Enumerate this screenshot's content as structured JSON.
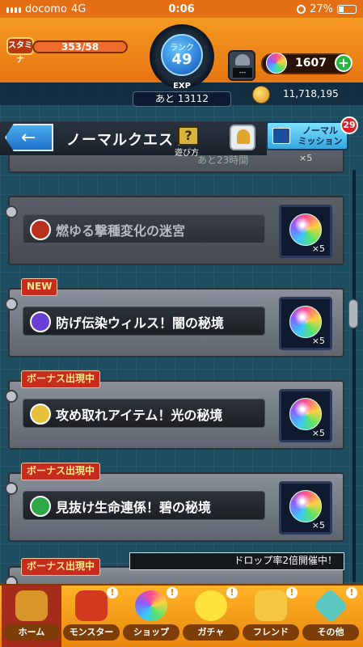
{
  "status_bar": {
    "carrier": "docomo",
    "network": "4G",
    "time": "0:06",
    "battery": "27%"
  },
  "header": {
    "stamina_label": "スタミナ",
    "stamina_value": "353/58",
    "rank_label": "ランク",
    "rank_value": "49",
    "exp_label": "EXP",
    "exp_remaining": "あと 13112",
    "shop_screen": "---",
    "orb_count": "1607",
    "plus_label": "+",
    "gold": "11,718,195"
  },
  "quest_header": {
    "back_icon": "left-arrow-icon",
    "title": "ノーマルクエスト",
    "help_mark": "?",
    "help_label": "遊び方",
    "mission_label": "ノーマル\nミッション",
    "mission_badge": "29",
    "faded_time": "あと23時間",
    "faded_reward": "×5"
  },
  "quests": [
    {
      "title": "燃ゆる撃種変化の迷宮",
      "tag": "",
      "reward": "×5",
      "element_color": "#b9311c",
      "dim": true
    },
    {
      "title": "防げ伝染ウィルス！闇の秘境",
      "tag": "NEW",
      "reward": "×5",
      "element_color": "#6b3fd6",
      "dim": false
    },
    {
      "title": "攻め取れアイテム！光の秘境",
      "tag": "ボーナス出現中",
      "reward": "×5",
      "element_color": "#e5c03a",
      "dim": false
    },
    {
      "title": "見抜け生命連係！碧の秘境",
      "tag": "ボーナス出現中",
      "reward": "×5",
      "element_color": "#2fa84b",
      "dim": false
    }
  ],
  "partial_quest": {
    "tag": "ボーナス出現中",
    "drop_banner": "ドロップ率2倍開催中！"
  },
  "tabs": [
    {
      "label": "ホーム",
      "icon": "home-icon",
      "color": "#d9952a",
      "alert": ""
    },
    {
      "label": "モンスター",
      "icon": "monster-icon",
      "color": "#d23a20",
      "alert": "!"
    },
    {
      "label": "ショップ",
      "icon": "orb-icon",
      "color": "#7fd6ff",
      "alert": "!"
    },
    {
      "label": "ガチャ",
      "icon": "gacha-icon",
      "color": "#ffe23b",
      "alert": "!"
    },
    {
      "label": "フレンド",
      "icon": "friend-icon",
      "color": "#f5c843",
      "alert": "!"
    },
    {
      "label": "その他",
      "icon": "other-icon",
      "color": "#5dc8c0",
      "alert": "!"
    }
  ]
}
